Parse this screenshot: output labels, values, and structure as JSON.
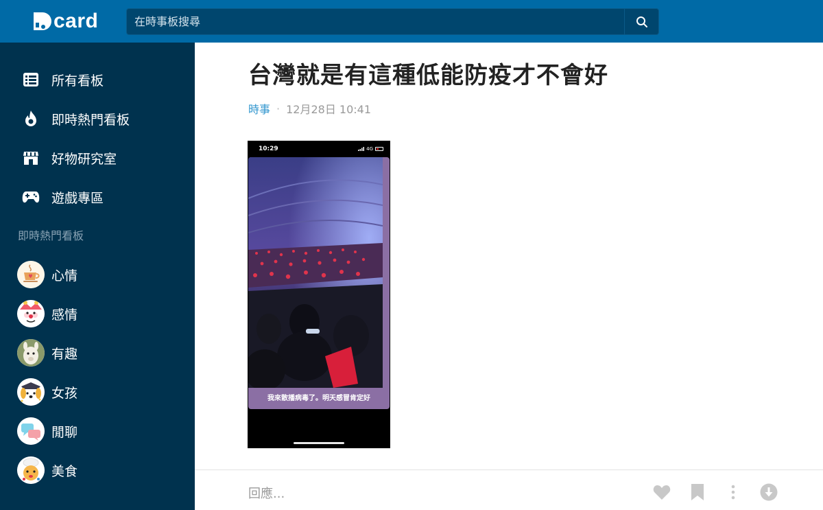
{
  "header": {
    "logo_text": "card",
    "search_placeholder": "在時事板搜尋"
  },
  "sidebar": {
    "nav": [
      {
        "label": "所有看板",
        "icon": "list-icon"
      },
      {
        "label": "即時熱門看板",
        "icon": "flame-icon"
      },
      {
        "label": "好物研究室",
        "icon": "store-icon"
      },
      {
        "label": "遊戲專區",
        "icon": "gamepad-icon"
      }
    ],
    "section_title": "即時熱門看板",
    "boards": [
      {
        "label": "心情",
        "icon": "coffee-cup-avatar"
      },
      {
        "label": "感情",
        "icon": "clown-avatar"
      },
      {
        "label": "有趣",
        "icon": "alpaca-avatar"
      },
      {
        "label": "女孩",
        "icon": "dog-avatar"
      },
      {
        "label": "閒聊",
        "icon": "chat-bubbles-avatar"
      },
      {
        "label": "美食",
        "icon": "chef-avatar"
      }
    ]
  },
  "post": {
    "title": "台灣就是有這種低能防疫才不會好",
    "forum": "時事",
    "separator": "·",
    "timestamp": "12月28日 10:41",
    "media": {
      "status_time": "10:29",
      "network": "4G",
      "caption": "我來散播病毒了。明天感冒肯定好"
    }
  },
  "footer": {
    "reply_placeholder": "回應...",
    "actions": [
      "heart-icon",
      "bookmark-icon",
      "more-vertical-icon",
      "download-icon"
    ]
  },
  "colors": {
    "header_bg": "#006aa6",
    "sidebar_bg": "#00324e",
    "forum_link": "#3397cf"
  }
}
